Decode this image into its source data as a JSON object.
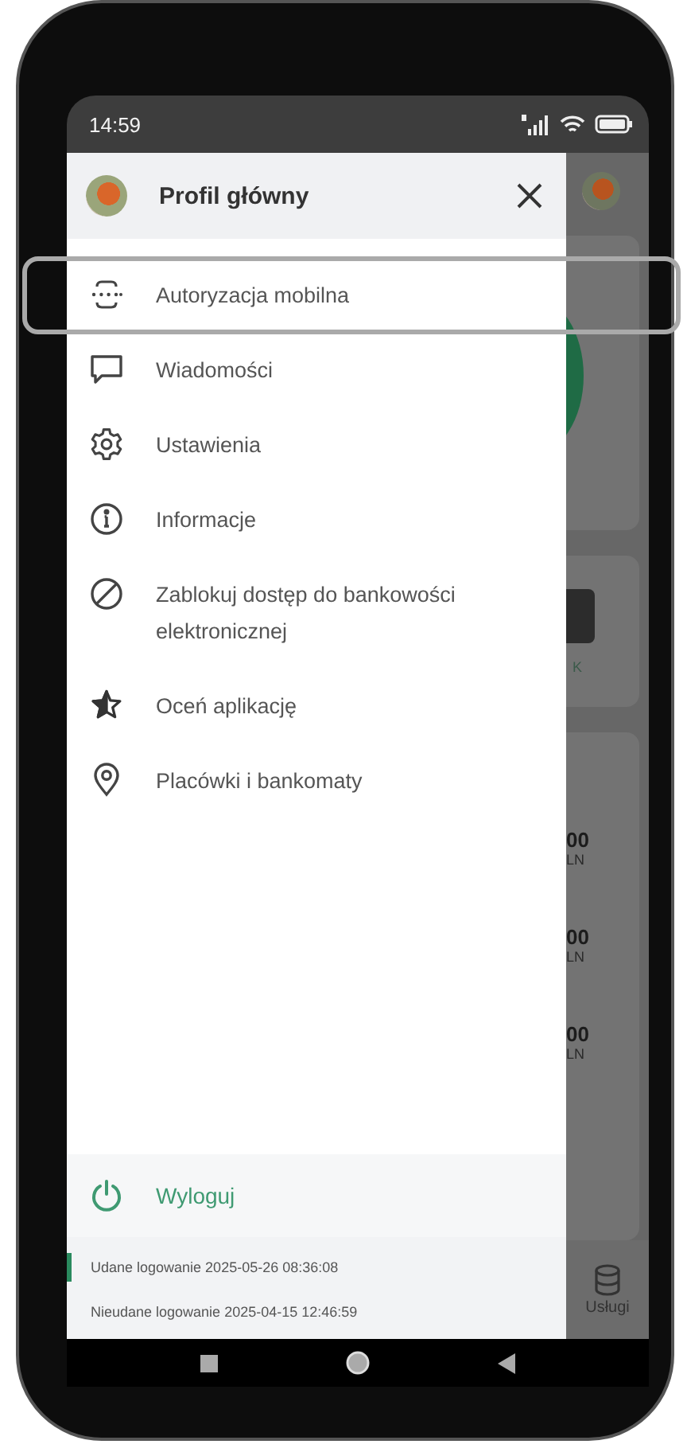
{
  "status_bar": {
    "time": "14:59"
  },
  "drawer": {
    "profile_name": "Profil główny",
    "items": [
      {
        "label": "Autoryzacja mobilna",
        "highlighted": true
      },
      {
        "label": "Wiadomości",
        "highlighted": false
      },
      {
        "label": "Ustawienia",
        "highlighted": false
      },
      {
        "label": "Informacje",
        "highlighted": false
      },
      {
        "label": "Zablokuj dostęp do bankowości elektronicznej",
        "highlighted": false
      },
      {
        "label": "Oceń aplikację",
        "highlighted": false
      },
      {
        "label": "Placówki i bankomaty",
        "highlighted": false
      }
    ],
    "logout": {
      "label": "Wyloguj"
    },
    "login_history": [
      {
        "text": "Udane logowanie 2025-05-26 08:36:08",
        "marked": true
      },
      {
        "text": "Nieudane logowanie 2025-04-15 12:46:59",
        "marked": false
      }
    ]
  },
  "background": {
    "tile_label": "K",
    "amounts": [
      {
        "value": "00",
        "currency": "LN"
      },
      {
        "value": "00",
        "currency": "LN"
      },
      {
        "value": "00",
        "currency": "LN"
      }
    ],
    "nav_label": "Usługi"
  }
}
